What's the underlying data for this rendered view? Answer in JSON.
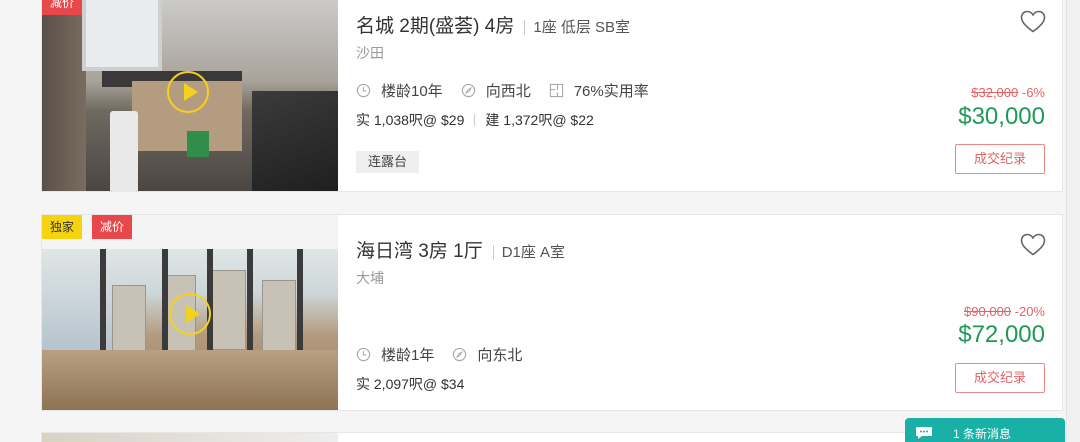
{
  "listings": [
    {
      "badges": [
        "减价"
      ],
      "title": "名城 2期(盛荟) 4房",
      "unit": "1座 低层 SB室",
      "district": "沙田",
      "age": "楼龄10年",
      "facing": "向西北",
      "efficiency": "76%实用率",
      "saleable_area": "实 1,038呎@ $29",
      "gross_area": "建 1,372呎@ $22",
      "tag": "连露台",
      "old_price": "$32,000",
      "discount": "-6%",
      "price": "$30,000",
      "deal_label": "成交纪录"
    },
    {
      "badges": [
        "独家",
        "减价"
      ],
      "title": "海日湾 3房 1厅",
      "unit": "D1座 A室",
      "district": "大埔",
      "age": "楼龄1年",
      "facing": "向东北",
      "saleable_area": "实 2,097呎@ $34",
      "old_price": "$90,000",
      "discount": "-20%",
      "price": "$72,000",
      "deal_label": "成交纪录"
    }
  ],
  "chat": {
    "label": "1 条新消息"
  },
  "colors": {
    "price_green": "#1f9a55",
    "discount_red": "#e06464",
    "badge_red": "#e8484a",
    "badge_yellow": "#f5d40f",
    "chat_teal": "#19b0a6"
  },
  "icons": [
    "clock-icon",
    "compass-icon",
    "floorplan-icon",
    "heart-icon",
    "play-icon",
    "chat-icon"
  ]
}
